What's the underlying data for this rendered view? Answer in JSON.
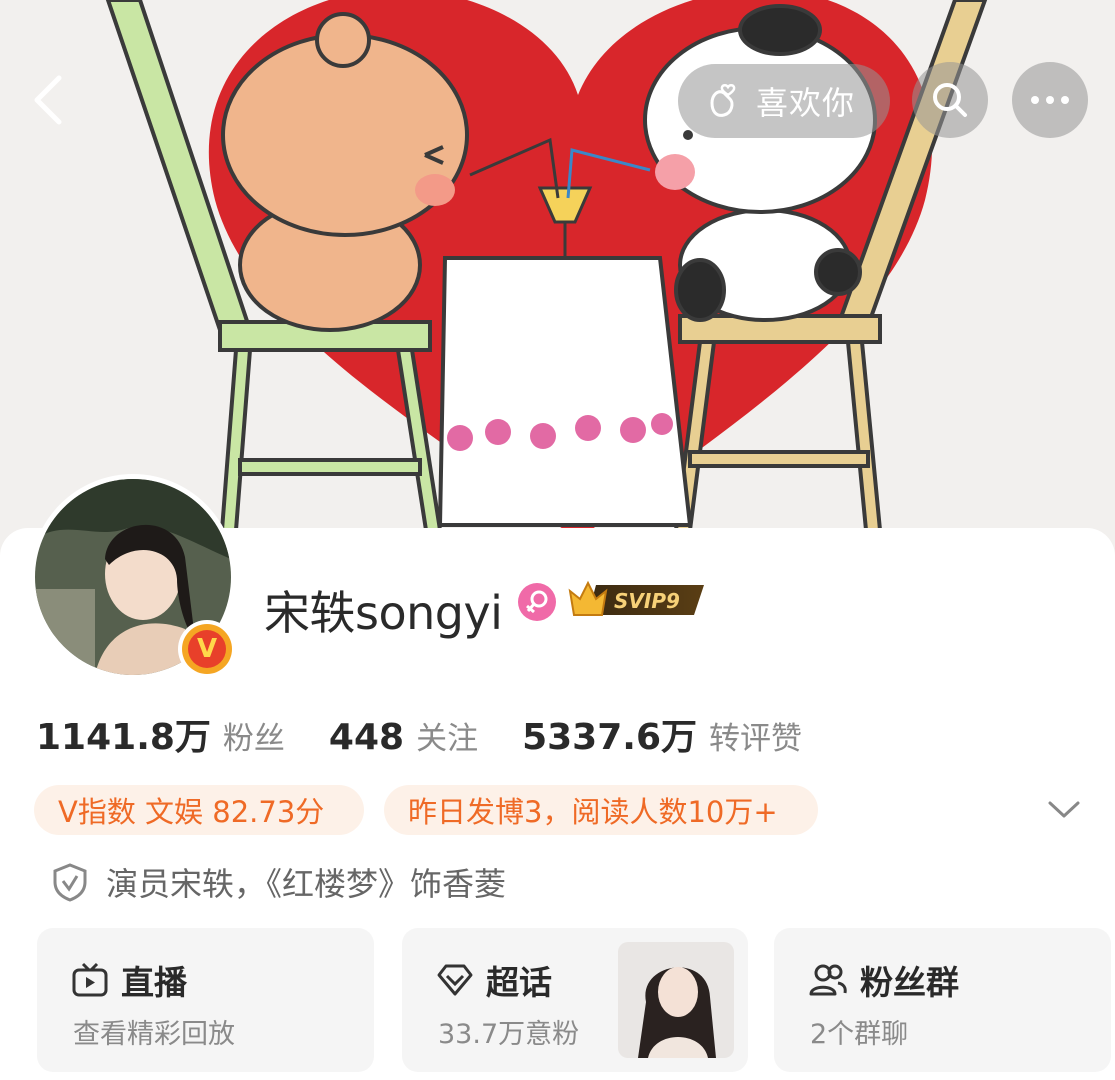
{
  "header": {
    "like_label": "喜欢你",
    "icons": {
      "back": "back-arrow-icon",
      "like": "hand-heart-icon",
      "search": "search-icon",
      "more": "more-icon"
    }
  },
  "profile": {
    "name": "宋轶songyi",
    "gender_icon": "female-icon",
    "vip_badge": "SVIP9",
    "verified_badge": "V"
  },
  "stats": [
    {
      "value": "1141.8万",
      "label": "粉丝"
    },
    {
      "value": "448",
      "label": "关注"
    },
    {
      "value": "5337.6万",
      "label": "转评赞"
    }
  ],
  "chips": {
    "v_index": "V指数 文娱 82.73分",
    "activity": "昨日发博3，阅读人数10万+"
  },
  "verification": {
    "text": "演员宋轶，《红楼梦》饰香菱"
  },
  "tiles": [
    {
      "title": "直播",
      "subtitle": "查看精彩回放",
      "icon": "live-tv-icon"
    },
    {
      "title": "超话",
      "subtitle": "33.7万意粉",
      "icon": "diamond-icon"
    },
    {
      "title": "粉丝群",
      "subtitle": "2个群聊",
      "icon": "group-icon"
    }
  ],
  "colors": {
    "accent_orange": "#ef6a26",
    "chip_bg": "#fdf1e8",
    "heart_red": "#d8262b",
    "gender_pink": "#f06aa8"
  }
}
